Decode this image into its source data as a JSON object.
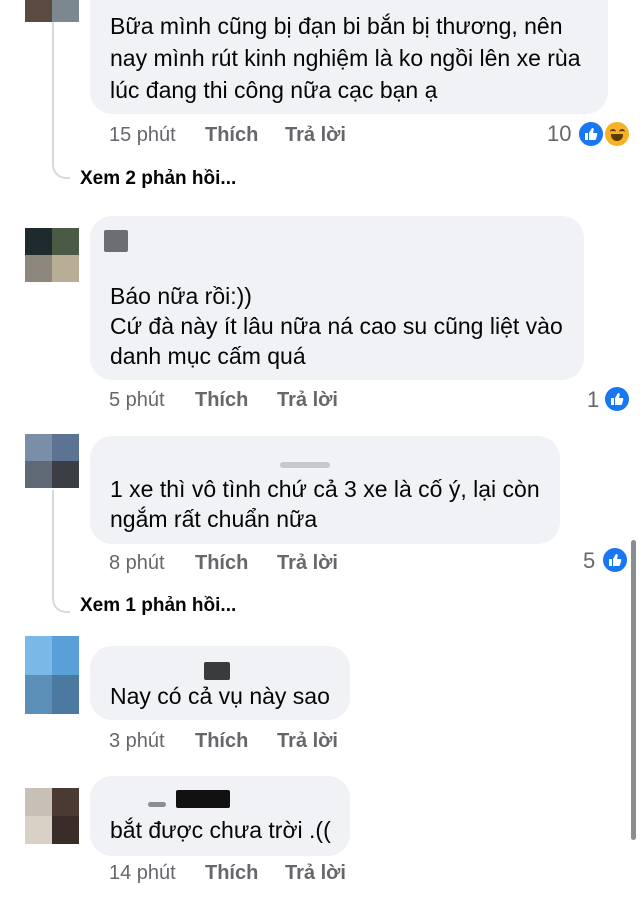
{
  "comments": [
    {
      "text_lines": [
        "Bữa mình cũng bị đạn bi bắn bị thương, nên",
        "nay mình rút kinh nghiệm là ko ngồi lên xe rùa",
        "lúc đang thi công nữa cạc bạn ạ"
      ],
      "time": "15 phút",
      "like": "Thích",
      "reply": "Trả lời",
      "reaction_count": "10",
      "reactions": [
        "like-icon",
        "haha-icon"
      ],
      "view_replies": "Xem 2 phản hồi..."
    },
    {
      "text_lines": [
        "Báo nữa rồi:))",
        "Cứ đà này ít lâu nữa ná cao su cũng liệt vào",
        "danh mục cấm quá"
      ],
      "time": "5 phút",
      "like": "Thích",
      "reply": "Trả lời",
      "reaction_count": "1",
      "reactions": [
        "like-icon"
      ]
    },
    {
      "text_lines": [
        "1 xe thì vô tình chứ cả 3 xe là cố ý, lại còn",
        "ngắm rất chuẩn nữa"
      ],
      "time": "8 phút",
      "like": "Thích",
      "reply": "Trả lời",
      "reaction_count": "5",
      "reactions": [
        "like-icon"
      ],
      "view_replies": "Xem 1 phản hồi..."
    },
    {
      "text_lines": [
        "Nay có cả vụ này sao"
      ],
      "time": "3 phút",
      "like": "Thích",
      "reply": "Trả lời"
    },
    {
      "text_lines": [
        "bắt được chưa trời .(("
      ],
      "time": "14 phút",
      "like": "Thích",
      "reply": "Trả lời"
    }
  ],
  "colors": {
    "bubble": "#f0f2f5",
    "meta_text": "#65676b",
    "like_blue": "#1877f2",
    "haha_yellow": "#f7b125"
  }
}
